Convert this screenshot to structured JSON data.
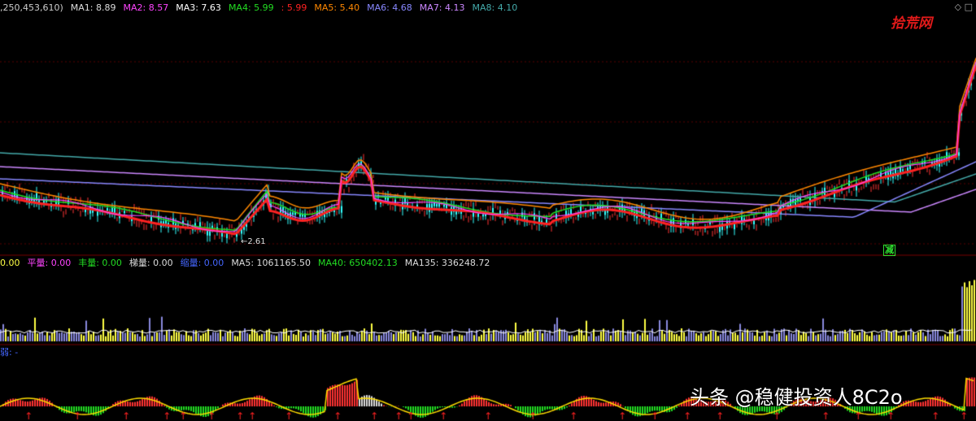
{
  "price_panel": {
    "legend": [
      {
        "label": ",250,453,610)",
        "color": "#cccccc"
      },
      {
        "label": "MA1: 8.89",
        "color": "#dddddd"
      },
      {
        "label": "MA2: 8.57",
        "color": "#ff44ff"
      },
      {
        "label": "MA3: 7.63",
        "color": "#ffffff"
      },
      {
        "label": "MA4: 5.99",
        "color": "#22dd22"
      },
      {
        "label": ": 5.99",
        "color": "#ff2222"
      },
      {
        "label": "MA5: 5.40",
        "color": "#ff8800"
      },
      {
        "label": "MA6: 4.68",
        "color": "#8888ff"
      },
      {
        "label": "MA7: 4.13",
        "color": "#cc88ff"
      },
      {
        "label": "MA8: 4.10",
        "color": "#44aaaa"
      }
    ],
    "low_marker": "2.61",
    "reduce_tag": "减",
    "logo": "拾荒网",
    "corner": "◇ □"
  },
  "volume_panel": {
    "legend": [
      {
        "label": "0.00",
        "color": "#ffff44"
      },
      {
        "label": "平量: 0.00",
        "color": "#ff44ff"
      },
      {
        "label": "丰量: 0.00",
        "color": "#22dd22"
      },
      {
        "label": "梯量: 0.00",
        "color": "#dddddd"
      },
      {
        "label": "缩量: 0.00",
        "color": "#4466ff"
      },
      {
        "label": "MA5: 1061165.50",
        "color": "#dddddd"
      },
      {
        "label": "MA40: 650402.13",
        "color": "#22dd22"
      },
      {
        "label": "MA135: 336248.72",
        "color": "#dddddd"
      }
    ]
  },
  "indicator_panel": {
    "legend": [
      {
        "label": "弱: -",
        "color": "#4466ff"
      }
    ]
  },
  "credit": "头条 @稳健投资人8C2o",
  "colors": {
    "background": "#000000",
    "grid": "#5a0000",
    "up": "#ff3333",
    "down": "#33ffff"
  }
}
